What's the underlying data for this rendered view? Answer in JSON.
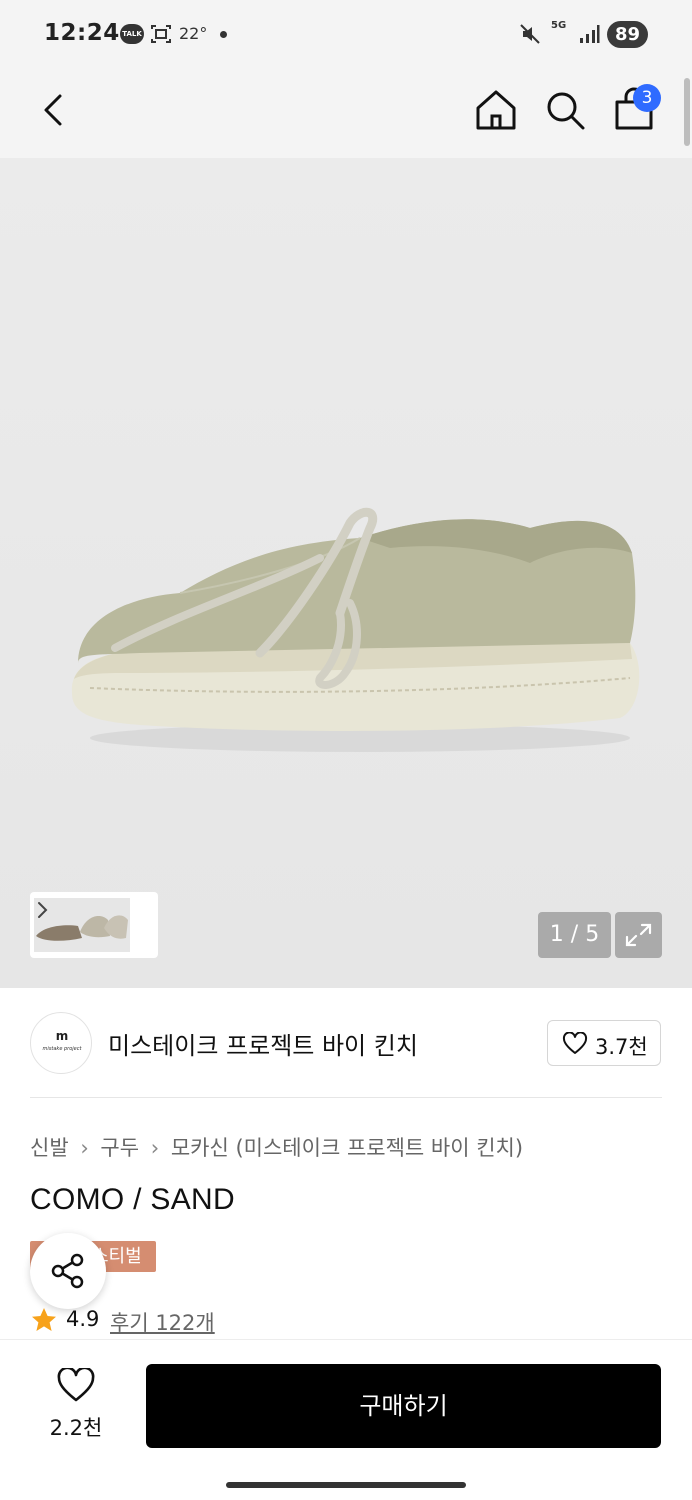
{
  "status_bar": {
    "time": "12:24",
    "talk_label": "TALK",
    "temperature": "22°",
    "network": "5G",
    "battery": "89"
  },
  "header": {
    "cart_count": "3"
  },
  "gallery": {
    "page_indicator": "1 / 5"
  },
  "brand": {
    "logo_mark": "m",
    "logo_text": "mistake project",
    "name": "미스테이크 프로젝트 바이 킨치",
    "like_count": "3.7천"
  },
  "breadcrumb": {
    "items": [
      "신발",
      "구두",
      "모카신 (미스테이크 프로젝트 바이 킨치)"
    ]
  },
  "product": {
    "title": "COMO / SAND",
    "badge": "스티벌",
    "rating": "4.9",
    "review_link": "후기 122개"
  },
  "bottom_bar": {
    "wish_count": "2.2천",
    "buy_label": "구매하기"
  },
  "colors": {
    "accent_badge": "#d58d71",
    "cart_badge": "#2f6bff",
    "star": "#f7a21b",
    "buy_button": "#000000"
  }
}
